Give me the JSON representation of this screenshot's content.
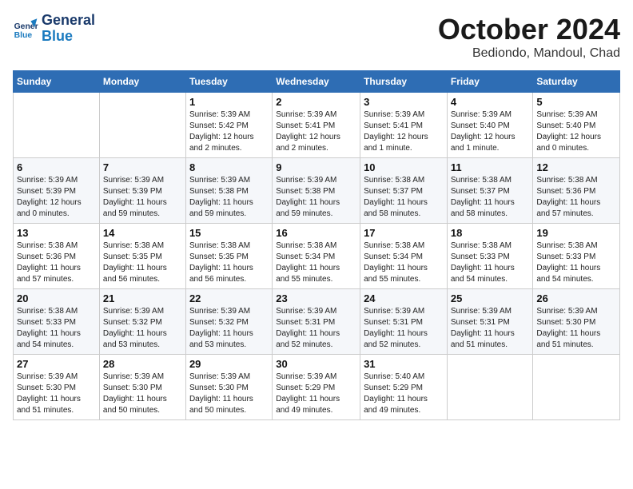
{
  "header": {
    "logo_line1": "General",
    "logo_line2": "Blue",
    "month_title": "October 2024",
    "location": "Bediondo, Mandoul, Chad"
  },
  "weekdays": [
    "Sunday",
    "Monday",
    "Tuesday",
    "Wednesday",
    "Thursday",
    "Friday",
    "Saturday"
  ],
  "weeks": [
    [
      {
        "day": "",
        "detail": ""
      },
      {
        "day": "",
        "detail": ""
      },
      {
        "day": "1",
        "detail": "Sunrise: 5:39 AM\nSunset: 5:42 PM\nDaylight: 12 hours\nand 2 minutes."
      },
      {
        "day": "2",
        "detail": "Sunrise: 5:39 AM\nSunset: 5:41 PM\nDaylight: 12 hours\nand 2 minutes."
      },
      {
        "day": "3",
        "detail": "Sunrise: 5:39 AM\nSunset: 5:41 PM\nDaylight: 12 hours\nand 1 minute."
      },
      {
        "day": "4",
        "detail": "Sunrise: 5:39 AM\nSunset: 5:40 PM\nDaylight: 12 hours\nand 1 minute."
      },
      {
        "day": "5",
        "detail": "Sunrise: 5:39 AM\nSunset: 5:40 PM\nDaylight: 12 hours\nand 0 minutes."
      }
    ],
    [
      {
        "day": "6",
        "detail": "Sunrise: 5:39 AM\nSunset: 5:39 PM\nDaylight: 12 hours\nand 0 minutes."
      },
      {
        "day": "7",
        "detail": "Sunrise: 5:39 AM\nSunset: 5:39 PM\nDaylight: 11 hours\nand 59 minutes."
      },
      {
        "day": "8",
        "detail": "Sunrise: 5:39 AM\nSunset: 5:38 PM\nDaylight: 11 hours\nand 59 minutes."
      },
      {
        "day": "9",
        "detail": "Sunrise: 5:39 AM\nSunset: 5:38 PM\nDaylight: 11 hours\nand 59 minutes."
      },
      {
        "day": "10",
        "detail": "Sunrise: 5:38 AM\nSunset: 5:37 PM\nDaylight: 11 hours\nand 58 minutes."
      },
      {
        "day": "11",
        "detail": "Sunrise: 5:38 AM\nSunset: 5:37 PM\nDaylight: 11 hours\nand 58 minutes."
      },
      {
        "day": "12",
        "detail": "Sunrise: 5:38 AM\nSunset: 5:36 PM\nDaylight: 11 hours\nand 57 minutes."
      }
    ],
    [
      {
        "day": "13",
        "detail": "Sunrise: 5:38 AM\nSunset: 5:36 PM\nDaylight: 11 hours\nand 57 minutes."
      },
      {
        "day": "14",
        "detail": "Sunrise: 5:38 AM\nSunset: 5:35 PM\nDaylight: 11 hours\nand 56 minutes."
      },
      {
        "day": "15",
        "detail": "Sunrise: 5:38 AM\nSunset: 5:35 PM\nDaylight: 11 hours\nand 56 minutes."
      },
      {
        "day": "16",
        "detail": "Sunrise: 5:38 AM\nSunset: 5:34 PM\nDaylight: 11 hours\nand 55 minutes."
      },
      {
        "day": "17",
        "detail": "Sunrise: 5:38 AM\nSunset: 5:34 PM\nDaylight: 11 hours\nand 55 minutes."
      },
      {
        "day": "18",
        "detail": "Sunrise: 5:38 AM\nSunset: 5:33 PM\nDaylight: 11 hours\nand 54 minutes."
      },
      {
        "day": "19",
        "detail": "Sunrise: 5:38 AM\nSunset: 5:33 PM\nDaylight: 11 hours\nand 54 minutes."
      }
    ],
    [
      {
        "day": "20",
        "detail": "Sunrise: 5:38 AM\nSunset: 5:33 PM\nDaylight: 11 hours\nand 54 minutes."
      },
      {
        "day": "21",
        "detail": "Sunrise: 5:39 AM\nSunset: 5:32 PM\nDaylight: 11 hours\nand 53 minutes."
      },
      {
        "day": "22",
        "detail": "Sunrise: 5:39 AM\nSunset: 5:32 PM\nDaylight: 11 hours\nand 53 minutes."
      },
      {
        "day": "23",
        "detail": "Sunrise: 5:39 AM\nSunset: 5:31 PM\nDaylight: 11 hours\nand 52 minutes."
      },
      {
        "day": "24",
        "detail": "Sunrise: 5:39 AM\nSunset: 5:31 PM\nDaylight: 11 hours\nand 52 minutes."
      },
      {
        "day": "25",
        "detail": "Sunrise: 5:39 AM\nSunset: 5:31 PM\nDaylight: 11 hours\nand 51 minutes."
      },
      {
        "day": "26",
        "detail": "Sunrise: 5:39 AM\nSunset: 5:30 PM\nDaylight: 11 hours\nand 51 minutes."
      }
    ],
    [
      {
        "day": "27",
        "detail": "Sunrise: 5:39 AM\nSunset: 5:30 PM\nDaylight: 11 hours\nand 51 minutes."
      },
      {
        "day": "28",
        "detail": "Sunrise: 5:39 AM\nSunset: 5:30 PM\nDaylight: 11 hours\nand 50 minutes."
      },
      {
        "day": "29",
        "detail": "Sunrise: 5:39 AM\nSunset: 5:30 PM\nDaylight: 11 hours\nand 50 minutes."
      },
      {
        "day": "30",
        "detail": "Sunrise: 5:39 AM\nSunset: 5:29 PM\nDaylight: 11 hours\nand 49 minutes."
      },
      {
        "day": "31",
        "detail": "Sunrise: 5:40 AM\nSunset: 5:29 PM\nDaylight: 11 hours\nand 49 minutes."
      },
      {
        "day": "",
        "detail": ""
      },
      {
        "day": "",
        "detail": ""
      }
    ]
  ]
}
